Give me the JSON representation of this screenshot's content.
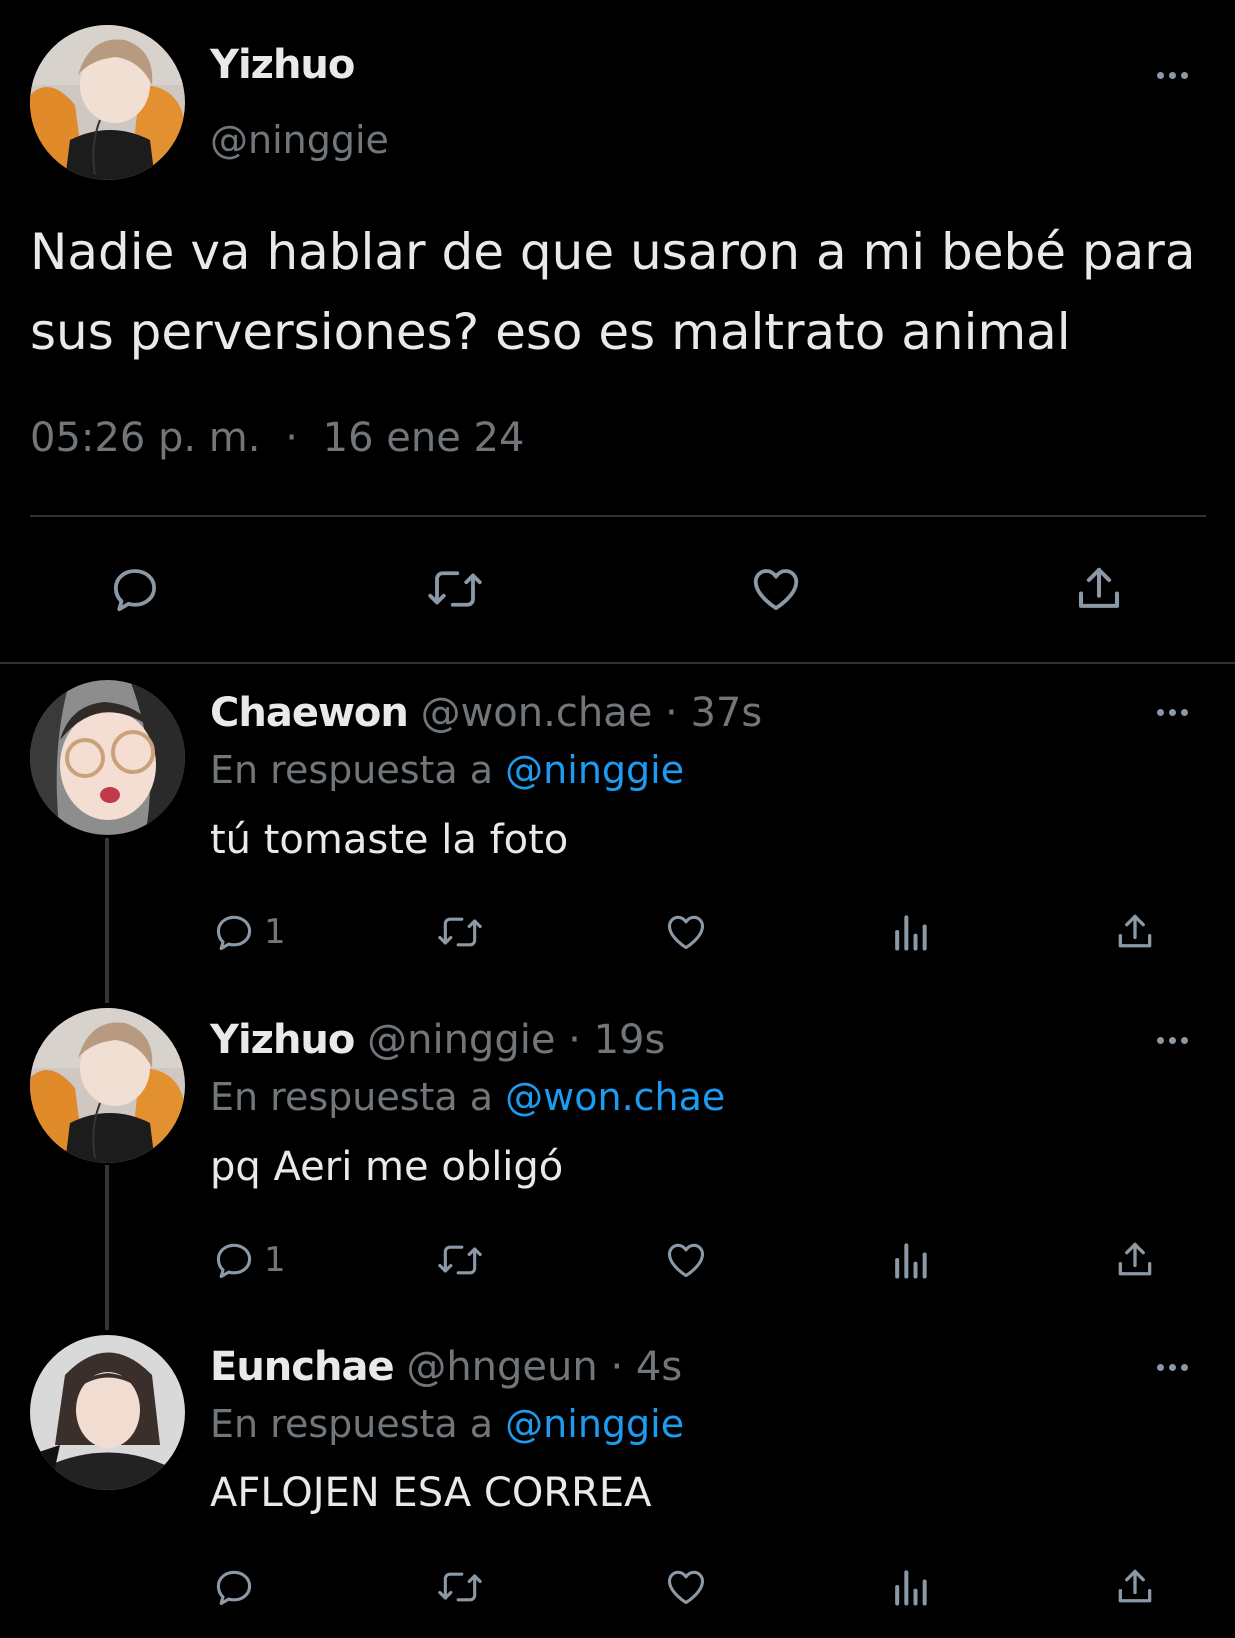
{
  "main_tweet": {
    "name": "Yizhuo",
    "handle": "@ninggie",
    "text": "Nadie va hablar de que usaron a mi bebé para sus perversiones? eso es maltrato animal",
    "time": "05:26 p. m.",
    "date": "16 ene 24",
    "separator": "·",
    "actions": [
      "reply-icon",
      "retweet-icon",
      "like-icon",
      "share-icon"
    ]
  },
  "replies": [
    {
      "name": "Chaewon",
      "handle": "@won.chae",
      "time": "37s",
      "reply_prefix": "En respuesta a",
      "reply_to": "@ninggie",
      "text": "tú tomaste la foto",
      "reply_count": "1"
    },
    {
      "name": "Yizhuo",
      "handle": "@ninggie",
      "time": "19s",
      "reply_prefix": "En respuesta a",
      "reply_to": "@won.chae",
      "text": "pq Aeri me obligó",
      "reply_count": "1"
    },
    {
      "name": "Eunchae",
      "handle": "@hngeun",
      "time": "4s",
      "reply_prefix": "En respuesta a",
      "reply_to": "@ninggie",
      "text": "AFLOJEN ESA CORREA",
      "reply_count": ""
    }
  ],
  "colors": {
    "background": "#000000",
    "text": "#e7e9ea",
    "secondary": "#71767b",
    "accent": "#1d9bf0",
    "divider": "#2f3336"
  }
}
